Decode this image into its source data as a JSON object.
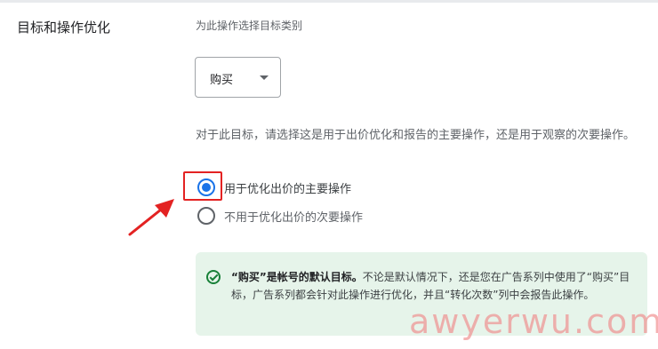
{
  "section": {
    "title": "目标和操作优化",
    "helper": "为此操作选择目标类别"
  },
  "dropdown": {
    "value": "购买"
  },
  "question": "对于此目标，请选择这是用于出价优化和报告的主要操作，还是用于观察的次要操作。",
  "radios": [
    {
      "label": "用于优化出价的主要操作",
      "checked": true
    },
    {
      "label": "不用于优化出价的次要操作",
      "checked": false
    }
  ],
  "info": {
    "bold": "“购买”是帐号的默认目标。",
    "text": "不论是默认情况下，还是您在广告系列中使用了“购买”目标，广告系列都会针对此操作进行优化，并且“转化次数”列中会报告此操作。"
  },
  "watermark": "awyerwu.com",
  "colors": {
    "accent": "#1a73e8",
    "success": "#188038",
    "success_bg": "#e6f4ea",
    "annotation": "#e32222"
  }
}
